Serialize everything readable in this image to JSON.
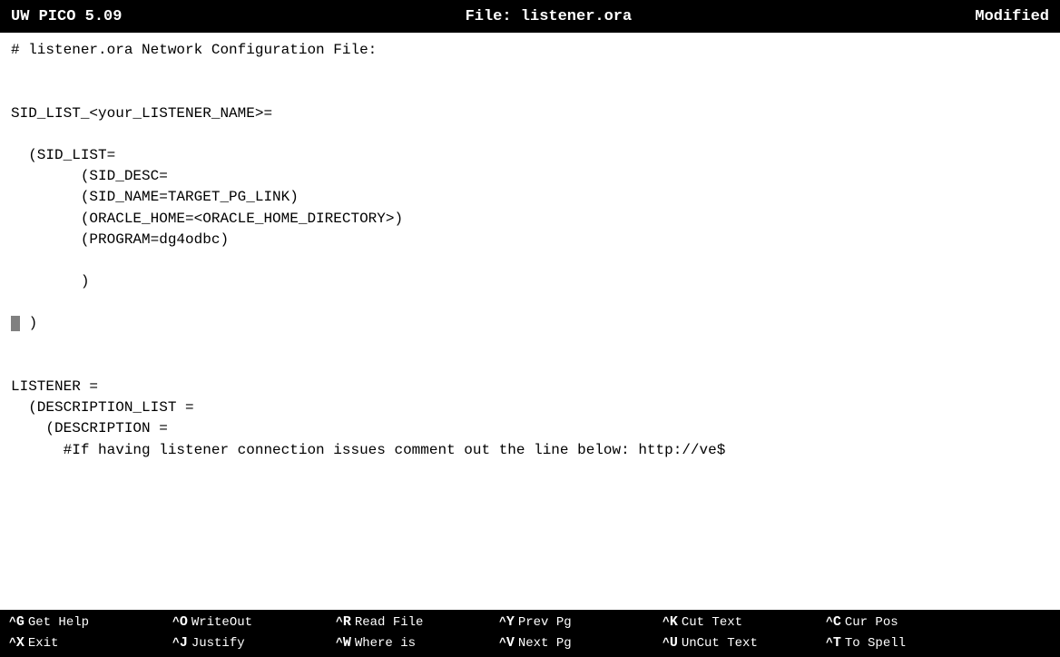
{
  "titlebar": {
    "app": "UW PICO 5.09",
    "file": "File: listener.ora",
    "status": "Modified"
  },
  "editor": {
    "lines": [
      "# listener.ora Network Configuration File:",
      "",
      "",
      "SID_LIST_<your_LISTENER_NAME>=",
      "",
      "  (SID_LIST=",
      "        (SID_DESC=",
      "        (SID_NAME=TARGET_PG_LINK)",
      "        (ORACLE_HOME=<ORACLE_HOME_DIRECTORY>)",
      "        (PROGRAM=dg4odbc)",
      "",
      "        )",
      "",
      "  )",
      "",
      "",
      "LISTENER =",
      "  (DESCRIPTION_LIST =",
      "    (DESCRIPTION =",
      "      #If having listener connection issues comment out the line below: http://ve$"
    ]
  },
  "shortcuts": {
    "row1": [
      {
        "ctrl": "^G",
        "label": "Get Help"
      },
      {
        "ctrl": "^O",
        "label": "WriteOut"
      },
      {
        "ctrl": "^R",
        "label": "Read File"
      },
      {
        "ctrl": "^Y",
        "label": "Prev Pg"
      },
      {
        "ctrl": "^K",
        "label": "Cut Text"
      },
      {
        "ctrl": "^C",
        "label": "Cur Pos"
      }
    ],
    "row2": [
      {
        "ctrl": "^X",
        "label": "Exit"
      },
      {
        "ctrl": "^J",
        "label": "Justify"
      },
      {
        "ctrl": "^W",
        "label": "Where is"
      },
      {
        "ctrl": "^V",
        "label": "Next Pg"
      },
      {
        "ctrl": "^U",
        "label": "UnCut Text"
      },
      {
        "ctrl": "^T",
        "label": "To Spell"
      }
    ]
  }
}
